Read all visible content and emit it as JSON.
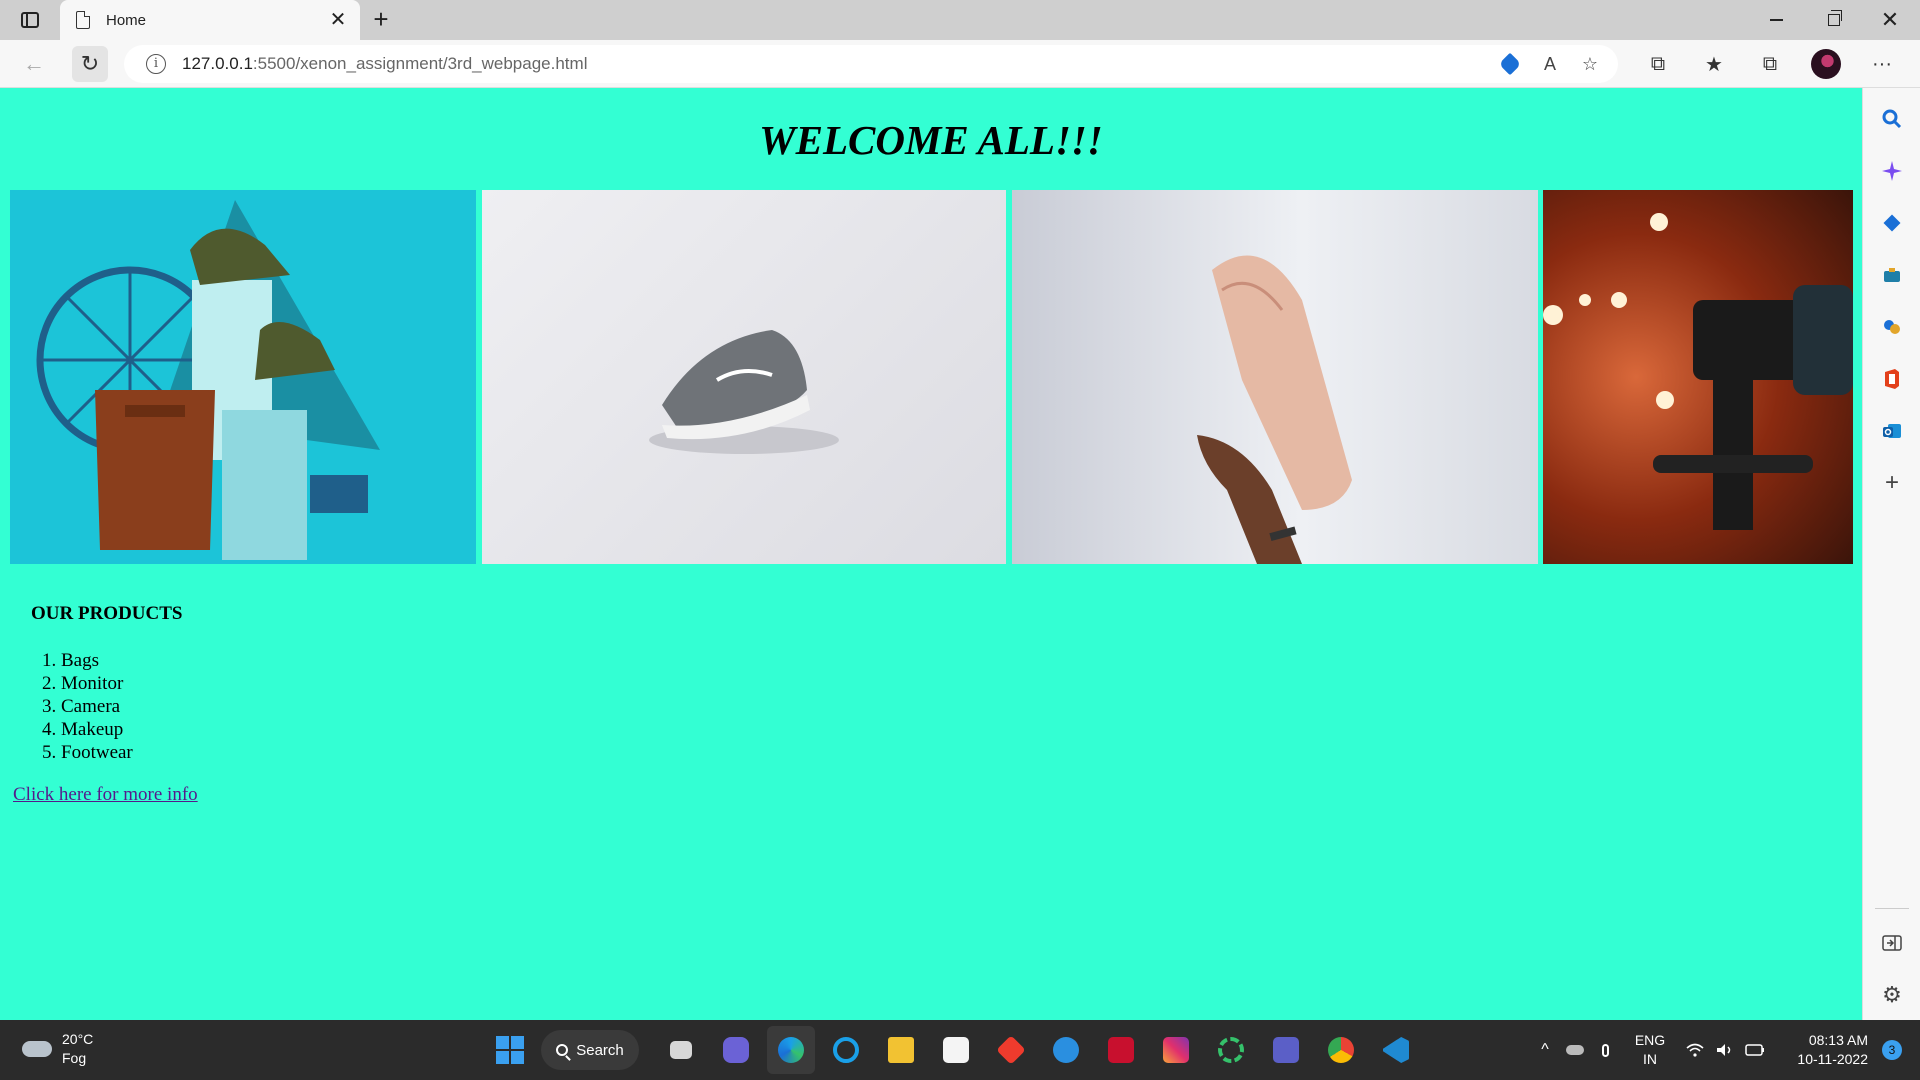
{
  "browser": {
    "tab": {
      "title": "Home",
      "close": "✕"
    },
    "new_tab": "+",
    "window_close": "✕",
    "address": {
      "host": "127.0.0.1",
      "rest": ":5500/xenon_assignment/3rd_webpage.html"
    },
    "icons": {
      "back": "←",
      "refresh": "↻",
      "info": "i",
      "read_aloud": "A",
      "favorite_add": "☆",
      "extensions": "⧉",
      "favorites": "★",
      "collections": "⧉",
      "more": "···"
    }
  },
  "sidebar": {
    "icons": [
      "search-icon",
      "copilot-icon",
      "shopping-icon",
      "tools-icon",
      "games-icon",
      "office-icon",
      "outlook-icon",
      "add-icon",
      "split-screen-icon",
      "settings-icon"
    ],
    "add": "+",
    "settings": "⚙"
  },
  "page": {
    "welcome": "WELCOME ALL!!!",
    "products_heading": "OUR PRODUCTS",
    "products": [
      "1. Bags",
      "2. Monitor",
      "3. Camera",
      "4. Makeup",
      "5. Footwear"
    ],
    "link": "Click here for more info"
  },
  "taskbar": {
    "weather": {
      "temp": "20°C",
      "condition": "Fog"
    },
    "search_label": "Search",
    "lang": {
      "line1": "ENG",
      "line2": "IN"
    },
    "clock": {
      "time": "08:13 AM",
      "date": "10-11-2022"
    },
    "notifications": "3"
  },
  "colors": {
    "page_bg": "#33ffd3",
    "link": "#551a8b"
  }
}
